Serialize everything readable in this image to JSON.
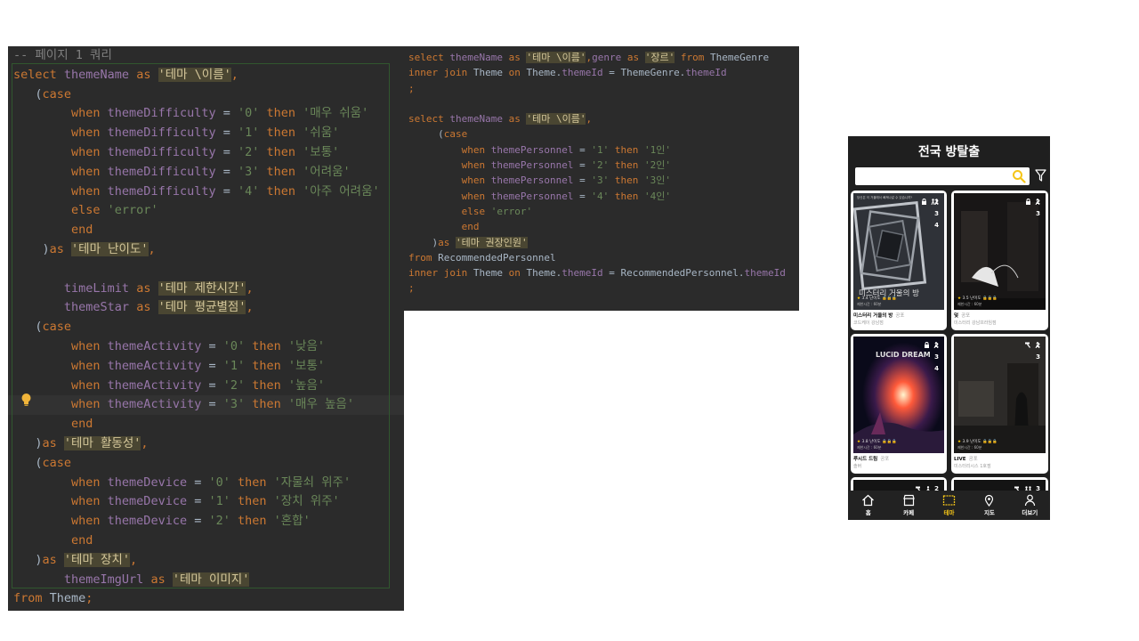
{
  "left_code": {
    "lines": [
      [
        [
          "cm",
          "-- 페이지 1 쿼리"
        ]
      ],
      [
        [
          "kw",
          "select "
        ],
        [
          "fld",
          "themeName "
        ],
        [
          "kw",
          "as "
        ],
        [
          "hl",
          "'테마 \\이름'"
        ],
        [
          "kw",
          ","
        ]
      ],
      [
        [
          "pl",
          "   ("
        ],
        [
          "kw",
          "case"
        ]
      ],
      [
        [
          "pl",
          "        "
        ],
        [
          "kw",
          "when "
        ],
        [
          "fld",
          "themeDifficulty"
        ],
        [
          "pl",
          " = "
        ],
        [
          "str",
          "'0' "
        ],
        [
          "kw",
          "then "
        ],
        [
          "str",
          "'매우 쉬움'"
        ]
      ],
      [
        [
          "pl",
          "        "
        ],
        [
          "kw",
          "when "
        ],
        [
          "fld",
          "themeDifficulty"
        ],
        [
          "pl",
          " = "
        ],
        [
          "str",
          "'1' "
        ],
        [
          "kw",
          "then "
        ],
        [
          "str",
          "'쉬움'"
        ]
      ],
      [
        [
          "pl",
          "        "
        ],
        [
          "kw",
          "when "
        ],
        [
          "fld",
          "themeDifficulty"
        ],
        [
          "pl",
          " = "
        ],
        [
          "str",
          "'2' "
        ],
        [
          "kw",
          "then "
        ],
        [
          "str",
          "'보통'"
        ]
      ],
      [
        [
          "pl",
          "        "
        ],
        [
          "kw",
          "when "
        ],
        [
          "fld",
          "themeDifficulty"
        ],
        [
          "pl",
          " = "
        ],
        [
          "str",
          "'3' "
        ],
        [
          "kw",
          "then "
        ],
        [
          "str",
          "'어려움'"
        ]
      ],
      [
        [
          "pl",
          "        "
        ],
        [
          "kw",
          "when "
        ],
        [
          "fld",
          "themeDifficulty"
        ],
        [
          "pl",
          " = "
        ],
        [
          "str",
          "'4' "
        ],
        [
          "kw",
          "then "
        ],
        [
          "str",
          "'아주 어려움'"
        ]
      ],
      [
        [
          "pl",
          "        "
        ],
        [
          "kw",
          "else "
        ],
        [
          "str",
          "'error'"
        ]
      ],
      [
        [
          "pl",
          "        "
        ],
        [
          "kw",
          "end"
        ]
      ],
      [
        [
          "pl",
          "    )"
        ],
        [
          "kw",
          "as "
        ],
        [
          "hl",
          "'테마 난이도'"
        ],
        [
          "kw",
          ","
        ]
      ],
      [
        [
          "pl",
          ""
        ]
      ],
      [
        [
          "pl",
          "       "
        ],
        [
          "fld",
          "timeLimit "
        ],
        [
          "kw",
          "as "
        ],
        [
          "hl",
          "'테마 제한시간'"
        ],
        [
          "kw",
          ","
        ]
      ],
      [
        [
          "pl",
          "       "
        ],
        [
          "fld",
          "themeStar "
        ],
        [
          "kw",
          "as "
        ],
        [
          "hl",
          "'테마 평균별점'"
        ],
        [
          "kw",
          ","
        ]
      ],
      [
        [
          "pl",
          "   ("
        ],
        [
          "kw",
          "case"
        ]
      ],
      [
        [
          "pl",
          "        "
        ],
        [
          "kw",
          "when "
        ],
        [
          "fld",
          "themeActivity"
        ],
        [
          "pl",
          " = "
        ],
        [
          "str",
          "'0' "
        ],
        [
          "kw",
          "then "
        ],
        [
          "str",
          "'낮음'"
        ]
      ],
      [
        [
          "pl",
          "        "
        ],
        [
          "kw",
          "when "
        ],
        [
          "fld",
          "themeActivity"
        ],
        [
          "pl",
          " = "
        ],
        [
          "str",
          "'1' "
        ],
        [
          "kw",
          "then "
        ],
        [
          "str",
          "'보통'"
        ]
      ],
      [
        [
          "pl",
          "        "
        ],
        [
          "kw",
          "when "
        ],
        [
          "fld",
          "themeActivity"
        ],
        [
          "pl",
          " = "
        ],
        [
          "str",
          "'2' "
        ],
        [
          "kw",
          "then "
        ],
        [
          "str",
          "'높음'"
        ]
      ],
      [
        [
          "pl",
          "        "
        ],
        [
          "kw",
          "when "
        ],
        [
          "fld",
          "themeActivity"
        ],
        [
          "pl",
          " = "
        ],
        [
          "str",
          "'3' "
        ],
        [
          "kw",
          "then "
        ],
        [
          "str",
          "'매우 높음'"
        ]
      ],
      [
        [
          "pl",
          "        "
        ],
        [
          "kw",
          "end"
        ]
      ],
      [
        [
          "pl",
          "   )"
        ],
        [
          "kw",
          "as "
        ],
        [
          "hl",
          "'테마 활동성'"
        ],
        [
          "kw",
          ","
        ]
      ],
      [
        [
          "pl",
          "   ("
        ],
        [
          "kw",
          "case"
        ]
      ],
      [
        [
          "pl",
          "        "
        ],
        [
          "kw",
          "when "
        ],
        [
          "fld",
          "themeDevice"
        ],
        [
          "pl",
          " = "
        ],
        [
          "str",
          "'0' "
        ],
        [
          "kw",
          "then "
        ],
        [
          "str",
          "'자물쇠 위주'"
        ]
      ],
      [
        [
          "pl",
          "        "
        ],
        [
          "kw",
          "when "
        ],
        [
          "fld",
          "themeDevice"
        ],
        [
          "pl",
          " = "
        ],
        [
          "str",
          "'1' "
        ],
        [
          "kw",
          "then "
        ],
        [
          "str",
          "'장치 위주'"
        ]
      ],
      [
        [
          "pl",
          "        "
        ],
        [
          "kw",
          "when "
        ],
        [
          "fld",
          "themeDevice"
        ],
        [
          "pl",
          " = "
        ],
        [
          "str",
          "'2' "
        ],
        [
          "kw",
          "then "
        ],
        [
          "str",
          "'혼합'"
        ]
      ],
      [
        [
          "pl",
          "        "
        ],
        [
          "kw",
          "end"
        ]
      ],
      [
        [
          "pl",
          "   )"
        ],
        [
          "kw",
          "as "
        ],
        [
          "hl",
          "'테마 장치'"
        ],
        [
          "kw",
          ","
        ]
      ],
      [
        [
          "pl",
          "       "
        ],
        [
          "fld",
          "themeImgUrl "
        ],
        [
          "kw",
          "as "
        ],
        [
          "hl",
          "'테마 이미지'"
        ]
      ],
      [
        [
          "kw",
          "from "
        ],
        [
          "pl",
          "Theme"
        ],
        [
          "kw",
          ";"
        ]
      ]
    ]
  },
  "right_code": {
    "lines": [
      [
        [
          "kw",
          "select "
        ],
        [
          "fld",
          "themeName "
        ],
        [
          "kw",
          "as "
        ],
        [
          "hl",
          "'테마 \\이름'"
        ],
        [
          "kw",
          ","
        ],
        [
          "fld",
          "genre "
        ],
        [
          "kw",
          "as "
        ],
        [
          "hl",
          "'장르'"
        ],
        [
          "kw",
          " from "
        ],
        [
          "pl",
          "ThemeGenre"
        ]
      ],
      [
        [
          "kw",
          "inner join "
        ],
        [
          "pl",
          "Theme "
        ],
        [
          "kw",
          "on "
        ],
        [
          "pl",
          "Theme."
        ],
        [
          "fld",
          "themeId"
        ],
        [
          "pl",
          " = ThemeGenre."
        ],
        [
          "fld",
          "themeId"
        ]
      ],
      [
        [
          "kw",
          ";"
        ]
      ],
      [
        [
          "pl",
          ""
        ]
      ],
      [
        [
          "kw",
          "select "
        ],
        [
          "fld",
          "themeName "
        ],
        [
          "kw",
          "as "
        ],
        [
          "hl",
          "'테마 \\이름'"
        ],
        [
          "kw",
          ","
        ]
      ],
      [
        [
          "pl",
          "     ("
        ],
        [
          "kw",
          "case"
        ]
      ],
      [
        [
          "pl",
          "         "
        ],
        [
          "kw",
          "when "
        ],
        [
          "fld",
          "themePersonnel"
        ],
        [
          "pl",
          " = "
        ],
        [
          "str",
          "'1' "
        ],
        [
          "kw",
          "then "
        ],
        [
          "str",
          "'1인'"
        ]
      ],
      [
        [
          "pl",
          "         "
        ],
        [
          "kw",
          "when "
        ],
        [
          "fld",
          "themePersonnel"
        ],
        [
          "pl",
          " = "
        ],
        [
          "str",
          "'2' "
        ],
        [
          "kw",
          "then "
        ],
        [
          "str",
          "'2인'"
        ]
      ],
      [
        [
          "pl",
          "         "
        ],
        [
          "kw",
          "when "
        ],
        [
          "fld",
          "themePersonnel"
        ],
        [
          "pl",
          " = "
        ],
        [
          "str",
          "'3' "
        ],
        [
          "kw",
          "then "
        ],
        [
          "str",
          "'3인'"
        ]
      ],
      [
        [
          "pl",
          "         "
        ],
        [
          "kw",
          "when "
        ],
        [
          "fld",
          "themePersonnel"
        ],
        [
          "pl",
          " = "
        ],
        [
          "str",
          "'4' "
        ],
        [
          "kw",
          "then "
        ],
        [
          "str",
          "'4인'"
        ]
      ],
      [
        [
          "pl",
          "         "
        ],
        [
          "kw",
          "else "
        ],
        [
          "str",
          "'error'"
        ]
      ],
      [
        [
          "pl",
          "         "
        ],
        [
          "kw",
          "end"
        ]
      ],
      [
        [
          "pl",
          "    )"
        ],
        [
          "kw",
          "as "
        ],
        [
          "hl",
          "'테마 권장인원'"
        ]
      ],
      [
        [
          "kw",
          "from "
        ],
        [
          "pl",
          "RecommendedPersonnel"
        ]
      ],
      [
        [
          "kw",
          "inner join "
        ],
        [
          "pl",
          "Theme "
        ],
        [
          "kw",
          "on "
        ],
        [
          "pl",
          "Theme."
        ],
        [
          "fld",
          "themeId"
        ],
        [
          "pl",
          " = RecommendedPersonnel."
        ],
        [
          "fld",
          "themeId"
        ]
      ],
      [
        [
          "kw",
          ";"
        ]
      ]
    ]
  },
  "app": {
    "title": "전국 방탈출",
    "search": {
      "value": "",
      "placeholder": ""
    },
    "cards": [
      {
        "name": "미스터리 거울의 방",
        "genre": "공포",
        "cafe": "코드케이 강남점",
        "poster_title": "미스터리 거울의 방",
        "poster_tagline": "당신은 이 거울에서 빠져나갈 수 있습니까?",
        "rating": "3.4",
        "difficulty_label": "난이도",
        "time_label": "제한시간 : 60분",
        "personnel": [
          "2",
          "3",
          "4"
        ]
      },
      {
        "name": "덫",
        "genre": "공포",
        "cafe": "미스터리 강남프라임점",
        "rating": "3.5",
        "difficulty_label": "난이도",
        "time_label": "제한시간 : 60분",
        "personnel": [
          "2",
          "3"
        ]
      },
      {
        "name": "루시드 드림",
        "genre": "공포",
        "cafe": "솔버",
        "poster_title": "LUCiD DREAM",
        "rating": "3.8",
        "difficulty_label": "난이도",
        "time_label": "제한시간 : 60분",
        "personnel": [
          "2",
          "3",
          "4"
        ]
      },
      {
        "name": "LIVE",
        "genre": "공포",
        "cafe": "미스터리시스 1호점",
        "rating": "3.9",
        "difficulty_label": "난이도",
        "time_label": "제한시간 : 60분",
        "personnel": [
          "2",
          "3"
        ]
      },
      {
        "personnel": [
          "2"
        ]
      },
      {
        "personnel": [
          "3"
        ]
      }
    ],
    "nav": [
      {
        "label": "홈",
        "icon": "home-icon"
      },
      {
        "label": "카페",
        "icon": "store-icon"
      },
      {
        "label": "테마",
        "icon": "theme-icon"
      },
      {
        "label": "지도",
        "icon": "map-pin-icon"
      },
      {
        "label": "더보기",
        "icon": "person-icon"
      }
    ],
    "active_nav": "테마",
    "colors": {
      "accent": "#f5c518",
      "app_bg": "#1f1f1f",
      "editor_bg": "#2b2b2b"
    }
  }
}
